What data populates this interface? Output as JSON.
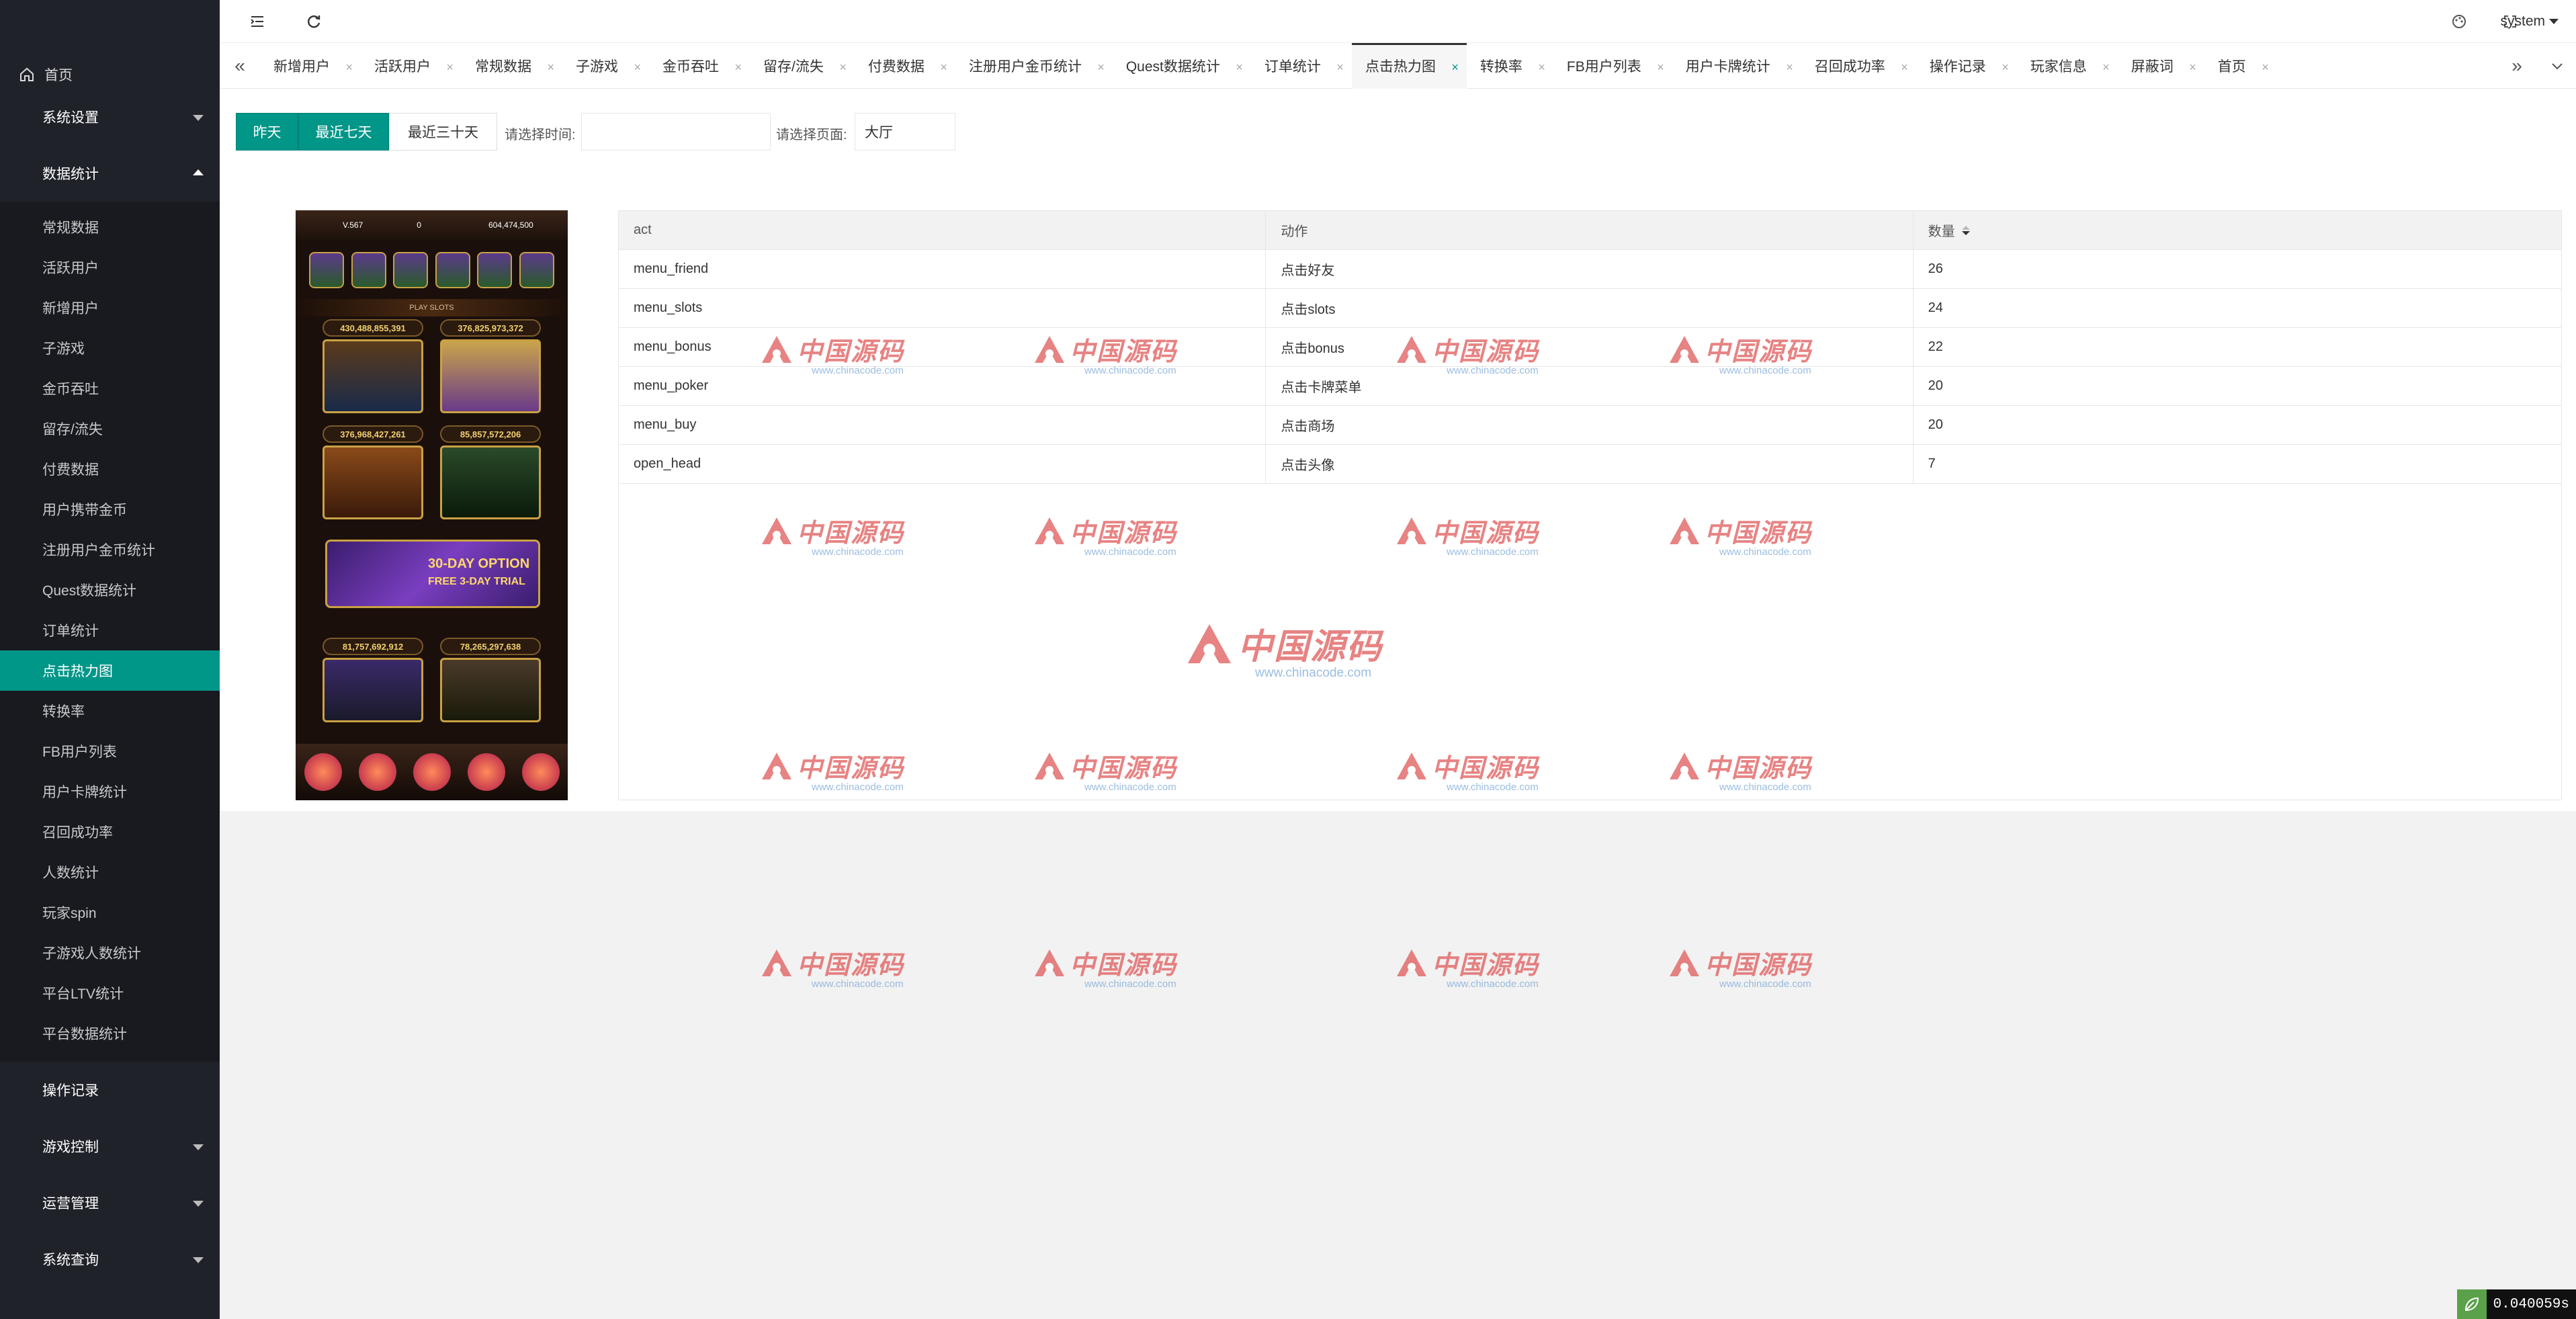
{
  "sidebar": {
    "home": "首页",
    "groups": [
      {
        "label": "系统设置"
      },
      {
        "label": "数据统计"
      },
      {
        "label": "操作记录"
      },
      {
        "label": "游戏控制"
      },
      {
        "label": "运营管理"
      },
      {
        "label": "系统查询"
      }
    ],
    "stats_items": [
      "常规数据",
      "活跃用户",
      "新增用户",
      "子游戏",
      "金币吞吐",
      "留存/流失",
      "付费数据",
      "用户携带金币",
      "注册用户金币统计",
      "Quest数据统计",
      "订单统计",
      "点击热力图",
      "转换率",
      "FB用户列表",
      "用户卡牌统计",
      "召回成功率",
      "人数统计",
      "玩家spin",
      "子游戏人数统计",
      "平台LTV统计",
      "平台数据统计"
    ],
    "active_item": "点击热力图"
  },
  "header": {
    "user": "system"
  },
  "tabs": [
    {
      "label": "新增用户"
    },
    {
      "label": "活跃用户"
    },
    {
      "label": "常规数据"
    },
    {
      "label": "子游戏"
    },
    {
      "label": "金币吞吐"
    },
    {
      "label": "留存/流失"
    },
    {
      "label": "付费数据"
    },
    {
      "label": "注册用户金币统计"
    },
    {
      "label": "Quest数据统计"
    },
    {
      "label": "订单统计"
    },
    {
      "label": "点击热力图",
      "active": true
    },
    {
      "label": "转换率"
    },
    {
      "label": "FB用户列表"
    },
    {
      "label": "用户卡牌统计"
    },
    {
      "label": "召回成功率"
    },
    {
      "label": "操作记录"
    },
    {
      "label": "玩家信息"
    },
    {
      "label": "屏蔽词"
    },
    {
      "label": "首页"
    }
  ],
  "filters": {
    "btn_yesterday": "昨天",
    "btn_7days": "最近七天",
    "btn_30days": "最近三十天",
    "time_label": "请选择时间:",
    "time_value": "",
    "page_label": "请选择页面:",
    "page_value": "大厅"
  },
  "phone": {
    "level": "V.567",
    "gems": "0",
    "coins": "604,474,500",
    "strip": "PLAY SLOTS",
    "jackpots": [
      "430,488,855,391",
      "376,825,973,372",
      "376,968,427,261",
      "85,857,572,206",
      "81,757,692,912",
      "78,265,297,638"
    ],
    "banner_line1": "30-DAY OPTION",
    "banner_line2": "FREE 3-DAY TRIAL"
  },
  "table": {
    "headers": [
      "act",
      "动作",
      "数量"
    ],
    "rows": [
      [
        "menu_friend",
        "点击好友",
        "26"
      ],
      [
        "menu_slots",
        "点击slots",
        "24"
      ],
      [
        "menu_bonus",
        "点击bonus",
        "22"
      ],
      [
        "menu_poker",
        "点击卡牌菜单",
        "20"
      ],
      [
        "menu_buy",
        "点击商场",
        "20"
      ],
      [
        "open_head",
        "点击头像",
        "7"
      ]
    ]
  },
  "watermark": {
    "text": "中国源码",
    "url": "www.chinacode.com"
  },
  "timer": "0.040059s",
  "colors": {
    "accent": "#009688",
    "sidebar_bg": "#20222a",
    "watermark": "#e05a5a"
  }
}
